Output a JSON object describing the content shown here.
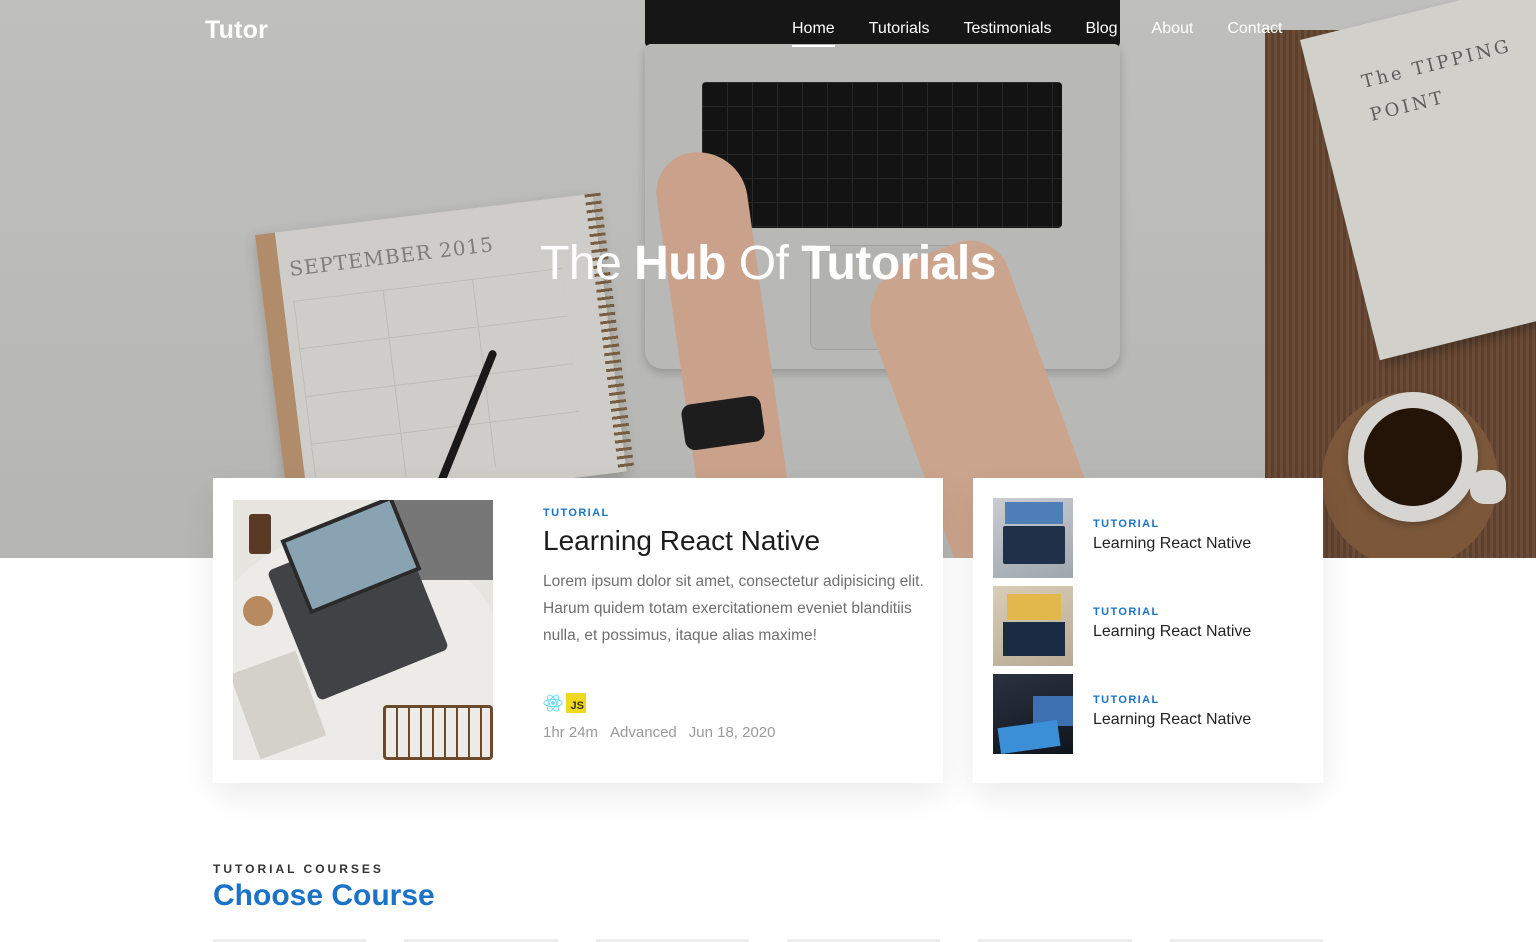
{
  "header": {
    "logo": "Tutor",
    "nav": [
      {
        "label": "Home",
        "active": true
      },
      {
        "label": "Tutorials",
        "active": false
      },
      {
        "label": "Testimonials",
        "active": false
      },
      {
        "label": "Blog",
        "active": false
      },
      {
        "label": "About",
        "active": false
      },
      {
        "label": "Contact",
        "active": false
      }
    ]
  },
  "hero": {
    "title_part1": "The",
    "title_part2": "Hub",
    "title_part3": "Of",
    "title_part4": "Tutorials",
    "background_props": {
      "planner_title": "SEPTEMBER 2015",
      "book_title": "The TIPPING POINT"
    }
  },
  "featured": {
    "tag": "TUTORIAL",
    "title": "Learning React Native",
    "description": "Lorem ipsum dolor sit amet, consectetur adipisicing elit. Harum quidem totam exercitationem eveniet blanditiis nulla, et possimus, itaque alias maxime!",
    "tech_icons": [
      "react-icon",
      "javascript-icon"
    ],
    "js_badge": "JS",
    "duration": "1hr 24m",
    "level": "Advanced",
    "date": "Jun 18, 2020"
  },
  "sidebar_list": [
    {
      "tag": "TUTORIAL",
      "title": "Learning React Native"
    },
    {
      "tag": "TUTORIAL",
      "title": "Learning React Native"
    },
    {
      "tag": "TUTORIAL",
      "title": "Learning React Native"
    }
  ],
  "courses": {
    "eyebrow": "TUTORIAL COURSES",
    "title": "Choose Course"
  },
  "colors": {
    "accent": "#1a73c7",
    "text_muted": "#6f6f6f",
    "js_yellow": "#f0d91c",
    "react_blue": "#61dafb"
  }
}
